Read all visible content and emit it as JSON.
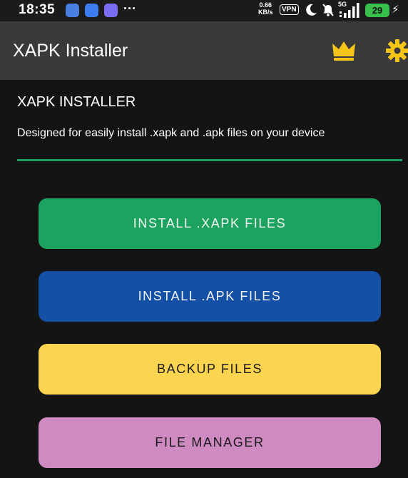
{
  "status_bar": {
    "time": "18:35",
    "more": "···",
    "speed_value": "0.66",
    "speed_unit": "KB/s",
    "vpn": "VPN",
    "network": "5G",
    "battery": "29"
  },
  "app_bar": {
    "title": "XAPK Installer",
    "crown_color": "#f5c518",
    "gear_color": "#f5c518"
  },
  "main": {
    "heading": "XAPK INSTALLER",
    "description": "Designed for easily install .xapk and .apk files on your device"
  },
  "buttons": {
    "install_xapk": "INSTALL .XAPK FILES",
    "install_apk": "INSTALL .APK FILES",
    "backup": "BACKUP FILES",
    "file_manager": "FILE MANAGER"
  },
  "colors": {
    "accent_green": "#1ba35f",
    "accent_blue": "#1350a6",
    "accent_yellow": "#fdd44f",
    "accent_pink": "#cf8ac2"
  }
}
